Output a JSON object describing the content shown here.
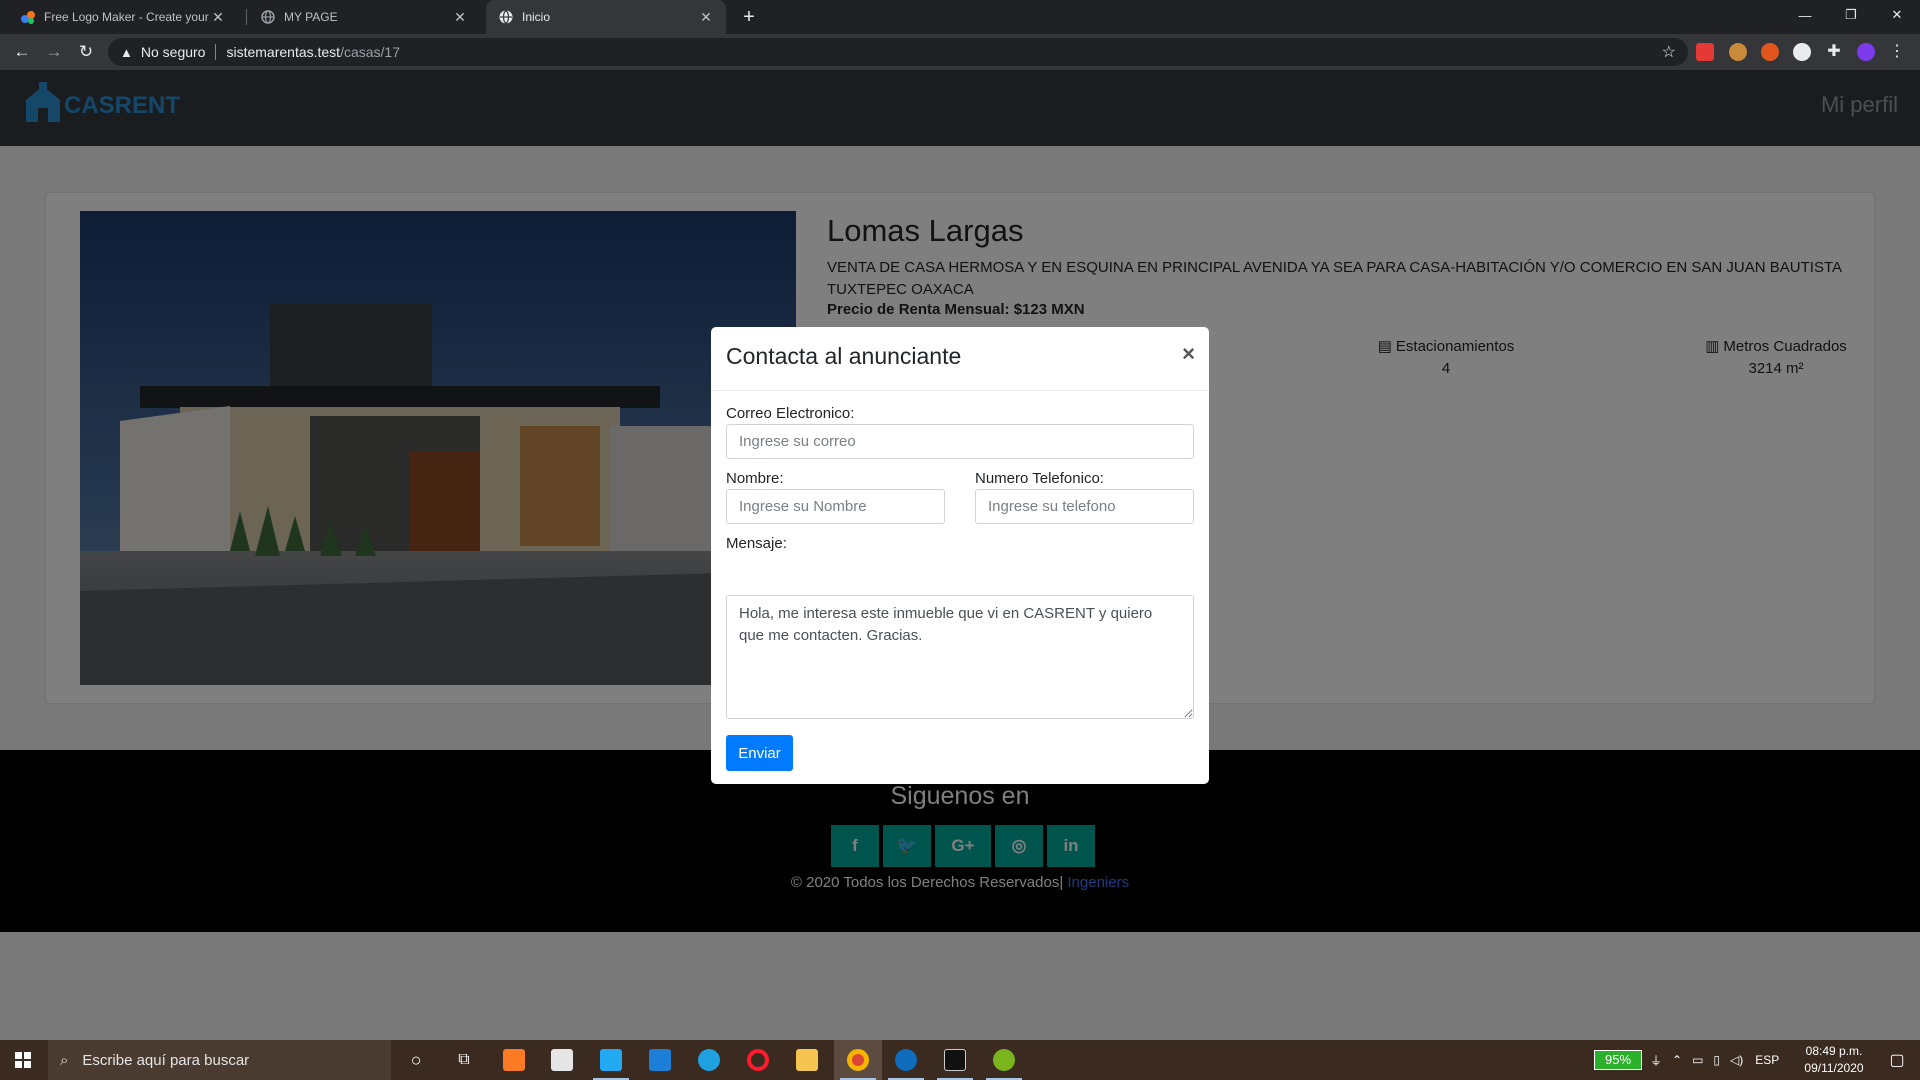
{
  "browser": {
    "tabs": [
      {
        "title": "Free Logo Maker - Create your o",
        "active": false
      },
      {
        "title": "MY PAGE",
        "active": false
      },
      {
        "title": "Inicio",
        "active": true
      }
    ],
    "address": {
      "security_label": "No seguro",
      "host": "sistemarentas.test",
      "path": "/casas/17"
    }
  },
  "site": {
    "brand": "CASRENT",
    "profile_link": "Mi perfil"
  },
  "property": {
    "title": "Lomas Largas",
    "description": "VENTA DE CASA HERMOSA Y EN ESQUINA EN PRINCIPAL AVENIDA YA SEA PARA CASA-HABITACIÓN Y/O COMERCIO EN SAN JUAN BAUTISTA TUXTEPEC OAXACA",
    "price": "Precio de Renta Mensual: $123 MXN",
    "features": [
      {
        "label": "Estacionamientos",
        "value": "4",
        "icon": "warehouse-icon"
      },
      {
        "label": "Metros Cuadrados",
        "value": "3214 m²",
        "icon": "map-icon"
      }
    ]
  },
  "modal": {
    "title": "Contacta al anunciante",
    "close": "×",
    "email_label": "Correo Electronico:",
    "email_placeholder": "Ingrese su correo",
    "name_label": "Nombre:",
    "name_placeholder": "Ingrese su Nombre",
    "phone_label": "Numero Telefonico:",
    "phone_placeholder": "Ingrese su telefono",
    "message_label": "Mensaje:",
    "message_value": "Hola, me interesa este inmueble que vi en CASRENT y quiero que me contacten. Gracias.",
    "submit": "Enviar"
  },
  "footer": {
    "follow": "Siguenos en",
    "socials": [
      "f",
      "🐦",
      "G+",
      "◎",
      "in"
    ],
    "copyright": "© 2020 Todos los Derechos Reservados|",
    "credit": " Ingeniers"
  },
  "taskbar": {
    "search_placeholder": "Escribe aquí para buscar",
    "battery": "95%",
    "language": "ESP",
    "time": "08:49 p.m.",
    "date": "09/11/2020"
  },
  "colors": {
    "accent": "#007bff",
    "social": "#00a99d",
    "brand": "#2a8fd0",
    "navbar": "#343a40"
  }
}
